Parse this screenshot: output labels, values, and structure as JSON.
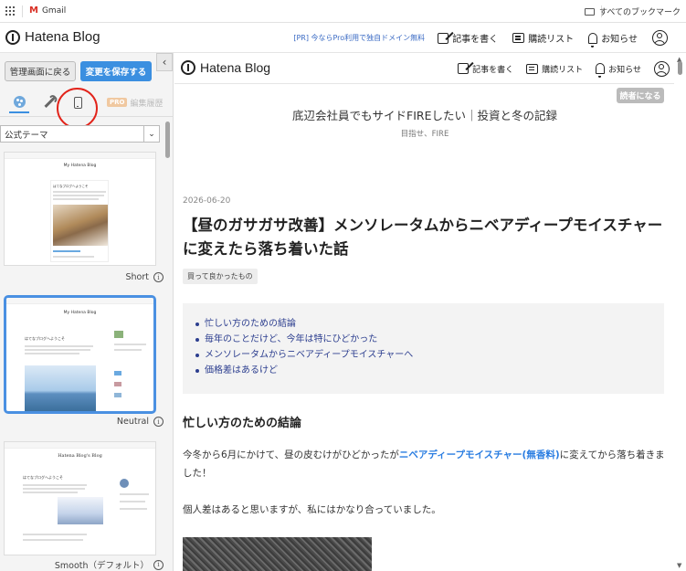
{
  "bookmarks_bar": {
    "gmail_label": "Gmail",
    "gmail_mark": "M",
    "all_bookmarks_label": "すべてのブックマーク"
  },
  "header": {
    "logo_text": "Hatena Blog",
    "pr_text": "[PR] 今ならPro利用で独自ドメイン無料",
    "write_label": "記事を書く",
    "reading_list_label": "購読リスト",
    "notifications_label": "お知らせ"
  },
  "sidebar": {
    "back_button_label": "管理画面に戻る",
    "save_button_label": "変更を保存する",
    "collapse_glyph": "‹",
    "pro_badge": "PRO",
    "history_label": "編集履歴",
    "select_value": "公式テーマ",
    "select_chevron": "⌄",
    "themes": [
      {
        "name": "Short",
        "preview_title": "My Hatena Blog",
        "preview_heading": "はてなブログへようこそ"
      },
      {
        "name": "Neutral",
        "preview_title": "My Hatena Blog",
        "preview_heading": "はてなブログへようこそ"
      },
      {
        "name": "Smooth（デフォルト）",
        "preview_title": "Hatena Blog's Blog",
        "preview_heading": "はてなブログへようこそ"
      }
    ],
    "info_glyph": "i"
  },
  "preview": {
    "logo_text": "Hatena Blog",
    "write_label": "記事を書く",
    "reading_list_label": "購読リスト",
    "notifications_label": "お知らせ",
    "reader_button": "読者になる",
    "blog_title": "底辺会社員でもサイドFIREしたい｜投資と冬の記録",
    "blog_subtitle": "目指せ、FIRE",
    "entry_date": "2026-06-20",
    "entry_title": "【昼のガサガサ改善】メンソレータムからニベアディープモイスチャーに変えたら落ち着いた話",
    "category": "買って良かったもの",
    "toc": [
      "忙しい方のための結論",
      "毎年のことだけど、今年は特にひどかった",
      "メンソレータムからニベアディープモイスチャーへ",
      "価格差はあるけど"
    ],
    "section_heading": "忙しい方のための結論",
    "para1_before": "今冬から6月にかけて、昼の皮むけがひどかったが",
    "para1_link": "ニベアディープモイスチャー(無香料)",
    "para1_after": "に変えてから落ち着きました！",
    "para2": "個人差はあると思いますが、私にはかなり合っていました。"
  },
  "colors": {
    "accent_blue": "#3b8fe0",
    "link_blue": "#2a7de1",
    "toc_link": "#2c3e8f",
    "annotation_red": "#e2231a"
  }
}
